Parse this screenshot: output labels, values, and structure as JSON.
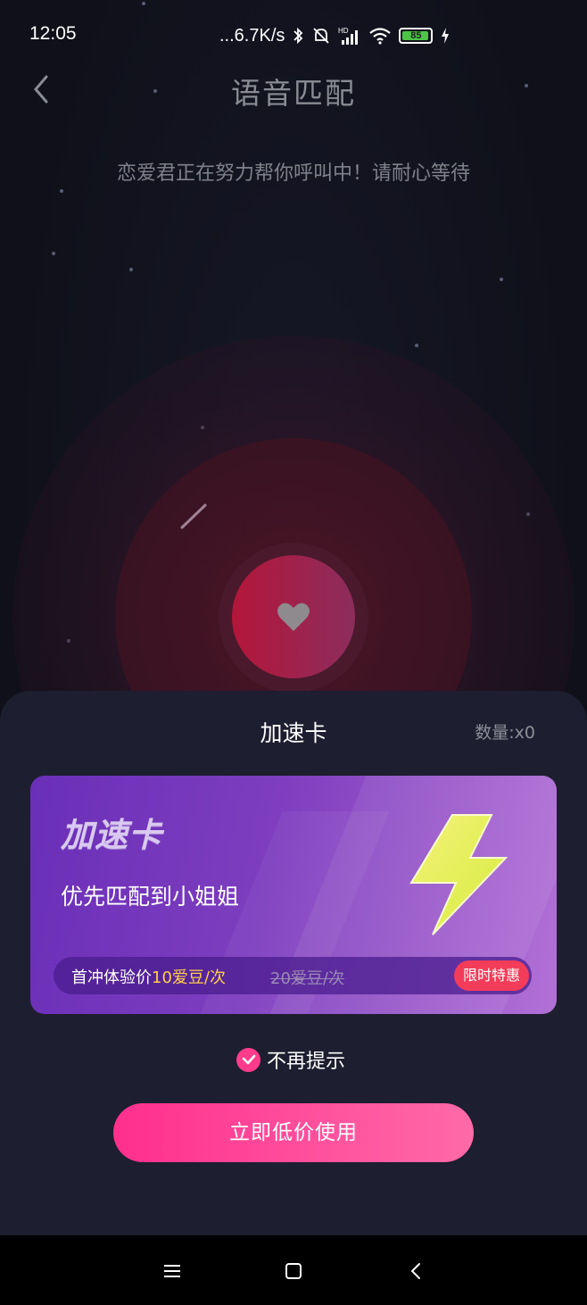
{
  "status_bar": {
    "time": "12:05",
    "network_speed": "...6.7K/s",
    "battery": "85"
  },
  "header": {
    "title": "语音匹配"
  },
  "subtitle": "恋爱君正在努力帮你呼叫中！请耐心等待",
  "sheet": {
    "title": "加速卡",
    "quantity": "数量:x0",
    "card": {
      "title": "加速卡",
      "description": "优先匹配到小姐姐",
      "price_label": "首冲体验价",
      "price_value": "10爱豆/次",
      "old_price": "20爱豆/次",
      "badge": "限时特惠"
    },
    "checkbox_label": "不再提示",
    "cta_label": "立即低价使用"
  },
  "colors": {
    "accent": "#ff3c8c",
    "card_purple": "#7e3ebf",
    "price_yellow": "#ffcf4a",
    "badge_red": "#f23c5a"
  },
  "icons": {
    "back": "chevron-left-icon",
    "heart": "heart-icon",
    "bolt": "lightning-bolt-icon",
    "check": "check-icon",
    "nav_menu": "menu-icon",
    "nav_home": "square-icon",
    "nav_back": "chevron-left-icon"
  }
}
